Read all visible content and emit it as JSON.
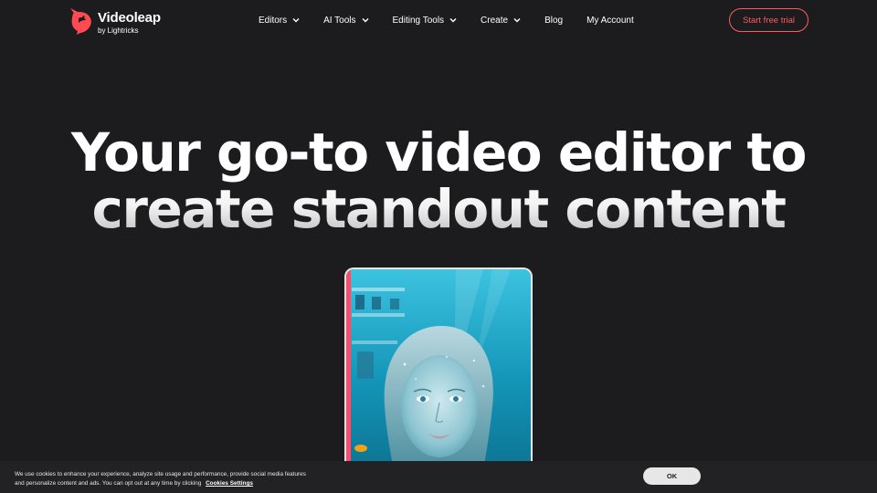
{
  "header": {
    "logo": {
      "name": "Videoleap",
      "sub": "by Lightricks"
    },
    "nav": [
      {
        "label": "Editors",
        "has_dropdown": true
      },
      {
        "label": "AI Tools",
        "has_dropdown": true
      },
      {
        "label": "Editing Tools",
        "has_dropdown": true
      },
      {
        "label": "Create",
        "has_dropdown": true
      },
      {
        "label": "Blog",
        "has_dropdown": false
      },
      {
        "label": "My Account",
        "has_dropdown": false
      }
    ],
    "cta_label": "Start free trial"
  },
  "hero": {
    "line1": "Your go-to video editor to",
    "line2": "create standout content"
  },
  "cookie": {
    "text": "We use cookies to enhance your experience, analyze site usage and performance, provide social media features and personalize content and ads. You can opt out at any time by clicking",
    "link": "Cookies Settings",
    "ok_label": "OK"
  },
  "colors": {
    "background": "#1c1c1e",
    "accent": "#ff5a5f",
    "cookie_bar": "#222224"
  },
  "icons": {
    "logo": "videoleap-bird-icon",
    "dropdown": "chevron-down-icon"
  }
}
